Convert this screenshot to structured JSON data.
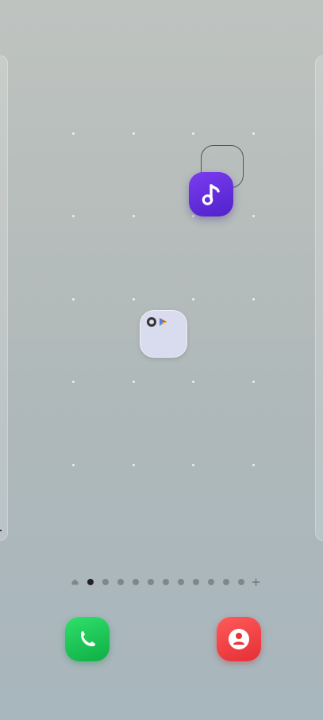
{
  "home_screen": {
    "grid_columns": 4,
    "grid_rows": 5,
    "apps": [
      {
        "name": "music-app",
        "icon": "music-note-icon",
        "color": "#5b2bd6"
      },
      {
        "name": "app-folder",
        "contains": [
          "settings-icon",
          "play-store-icon"
        ],
        "color": "#d9dbee"
      }
    ]
  },
  "page_indicator": {
    "pages": 12,
    "current_page": 2,
    "first": "home-icon",
    "last": "+"
  },
  "dock": [
    {
      "name": "phone-app",
      "icon": "phone-icon",
      "color": "#18c24f"
    },
    {
      "name": "contacts-app",
      "icon": "contact-person-icon",
      "color": "#f0393e"
    }
  ]
}
